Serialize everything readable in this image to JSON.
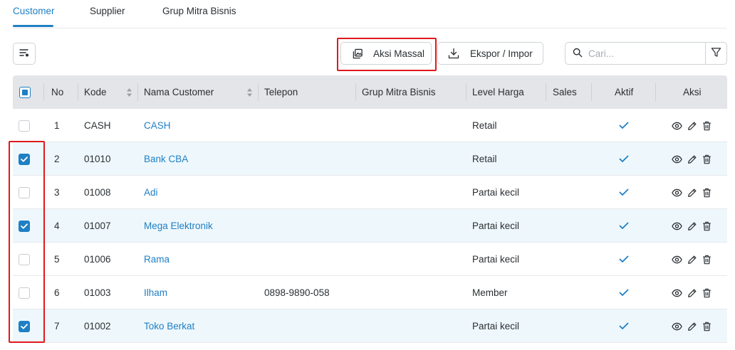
{
  "tabs": [
    {
      "label": "Customer",
      "active": true
    },
    {
      "label": "Supplier",
      "active": false
    },
    {
      "label": "Grup Mitra Bisnis",
      "active": false
    }
  ],
  "toolbar": {
    "settings_icon": "list-settings-icon",
    "bulk_action_label": "Aksi Massal",
    "export_import_label": "Ekspor / Impor",
    "search_placeholder": "Cari...",
    "search_value": ""
  },
  "colors": {
    "accent": "#1f7fc4",
    "highlight": "#e0191b",
    "header_bg": "#e3e5e8",
    "selected_row_bg": "#eef8fc"
  },
  "table": {
    "columns": {
      "no": "No",
      "kode": "Kode",
      "nama": "Nama Customer",
      "telepon": "Telepon",
      "grup": "Grup Mitra Bisnis",
      "level": "Level Harga",
      "sales": "Sales",
      "aktif": "Aktif",
      "aksi": "Aksi"
    },
    "header_checkbox": "indeterminate",
    "rows": [
      {
        "no": "1",
        "kode": "CASH",
        "nama": "CASH",
        "telepon": "",
        "grup": "",
        "level": "Retail",
        "sales": "",
        "aktif": true,
        "selected": false
      },
      {
        "no": "2",
        "kode": "01010",
        "nama": "Bank CBA",
        "telepon": "",
        "grup": "",
        "level": "Retail",
        "sales": "",
        "aktif": true,
        "selected": true
      },
      {
        "no": "3",
        "kode": "01008",
        "nama": "Adi",
        "telepon": "",
        "grup": "",
        "level": "Partai kecil",
        "sales": "",
        "aktif": true,
        "selected": false
      },
      {
        "no": "4",
        "kode": "01007",
        "nama": "Mega Elektronik",
        "telepon": "",
        "grup": "",
        "level": "Partai kecil",
        "sales": "",
        "aktif": true,
        "selected": true
      },
      {
        "no": "5",
        "kode": "01006",
        "nama": "Rama",
        "telepon": "",
        "grup": "",
        "level": "Partai kecil",
        "sales": "",
        "aktif": true,
        "selected": false
      },
      {
        "no": "6",
        "kode": "01003",
        "nama": "Ilham",
        "telepon": "0898-9890-058",
        "grup": "",
        "level": "Member",
        "sales": "",
        "aktif": true,
        "selected": false
      },
      {
        "no": "7",
        "kode": "01002",
        "nama": "Toko Berkat",
        "telepon": "",
        "grup": "",
        "level": "Partai kecil",
        "sales": "",
        "aktif": true,
        "selected": true
      }
    ]
  }
}
